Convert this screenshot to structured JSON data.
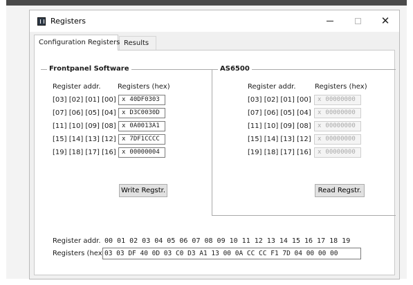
{
  "window": {
    "title": "Registers",
    "minimize_glyph": "",
    "maximize_glyph": "",
    "close_glyph": "✕"
  },
  "tabs": [
    {
      "label": "Configuration Registers",
      "selected": true
    },
    {
      "label": "Results",
      "selected": false
    }
  ],
  "frontpanel": {
    "title": "Frontpanel Software",
    "addr_header": "Register addr.",
    "hex_header": "Registers (hex)",
    "rows": [
      {
        "addr": "[03] [02] [01] [00] :",
        "prefix": "x",
        "value": "40DF0303"
      },
      {
        "addr": "[07] [06] [05] [04] :",
        "prefix": "x",
        "value": "D3C0030D"
      },
      {
        "addr": "[11] [10] [09] [08] :",
        "prefix": "x",
        "value": "0A0013A1"
      },
      {
        "addr": "[15] [14] [13] [12] :",
        "prefix": "x",
        "value": "7DF1CCCC"
      },
      {
        "addr": "[19] [18] [17] [16] :",
        "prefix": "x",
        "value": "00000004"
      }
    ],
    "button_label": "Write Regstr."
  },
  "as6500": {
    "title": "AS6500",
    "addr_header": "Register addr.",
    "hex_header": "Registers (hex)",
    "rows": [
      {
        "addr": "[03] [02] [01] [00] :",
        "prefix": "x",
        "value": "00000000"
      },
      {
        "addr": "[07] [06] [05] [04] :",
        "prefix": "x",
        "value": "00000000"
      },
      {
        "addr": "[11] [10] [09] [08] :",
        "prefix": "x",
        "value": "00000000"
      },
      {
        "addr": "[15] [14] [13] [12] :",
        "prefix": "x",
        "value": "00000000"
      },
      {
        "addr": "[19] [18] [17] [16] :",
        "prefix": "x",
        "value": "00000000"
      }
    ],
    "button_label": "Read Regstr."
  },
  "bytes": {
    "addr_label": "Register addr.",
    "addr_values": "00 01 02 03 04 05 06 07 08 09 10 11 12 13 14 15 16 17 18 19",
    "hex_label": "Registers (hex)",
    "hex_values": "03 03 DF 40 0D 03 C0 D3 A1 13 00 0A CC CC F1 7D 04 00 00 00"
  }
}
